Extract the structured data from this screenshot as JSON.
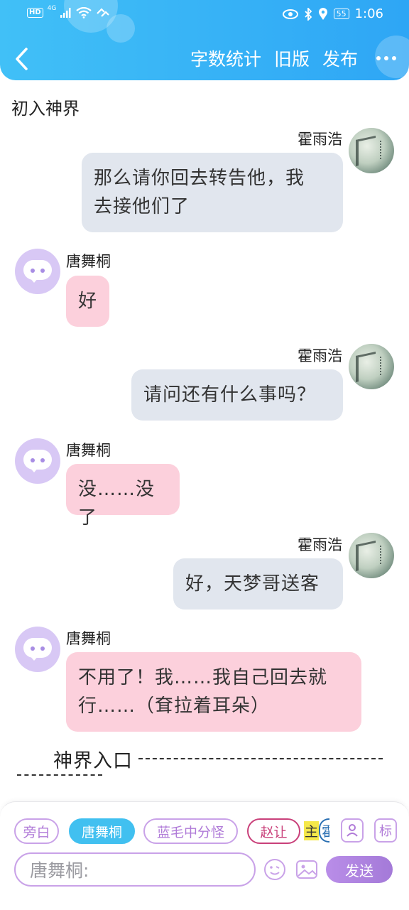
{
  "status_bar": {
    "left_badges": [
      "HD",
      "4G"
    ],
    "battery": "55",
    "time": "1:06"
  },
  "header": {
    "actions": [
      "字数统计",
      "旧版",
      "发布"
    ],
    "accent": "#3bb4f6"
  },
  "chapter_title": "初入神界",
  "messages": [
    {
      "side": "right",
      "name": "霍雨浩",
      "text_lines": [
        "那么请你回去转告他，我",
        "去接他们了"
      ]
    },
    {
      "side": "left",
      "name": "唐舞桐",
      "text_lines": [
        "好"
      ]
    },
    {
      "side": "right",
      "name": "霍雨浩",
      "text_lines": [
        "请问还有什么事吗？"
      ]
    },
    {
      "side": "left",
      "name": "唐舞桐",
      "text_lines": [
        "没……没了"
      ]
    },
    {
      "side": "right",
      "name": "霍雨浩",
      "text_lines": [
        "好，天梦哥送客"
      ]
    },
    {
      "side": "left",
      "name": "唐舞桐",
      "text_lines": [
        "不用了！我……我自己回去就",
        "行……（耷拉着耳朵）"
      ]
    }
  ],
  "narration": "神界入口",
  "role_chips": [
    {
      "label": "旁白",
      "state": "outline"
    },
    {
      "label": "唐舞桐",
      "state": "active"
    },
    {
      "label": "蓝毛中分怪",
      "state": "outline"
    },
    {
      "label": "赵让",
      "state": "red"
    },
    {
      "label": "主",
      "state": "highlight",
      "trailing": "霍"
    }
  ],
  "tool_icons": [
    "person-icon",
    "label-icon"
  ],
  "tag_label": "标",
  "input": {
    "placeholder": "唐舞桐:"
  },
  "send_label": "发送",
  "colors": {
    "right_bubble": "#e1e6ee",
    "left_bubble": "#fcd0dc",
    "purple": "#b07bd8",
    "active_chip": "#41c0f0"
  }
}
